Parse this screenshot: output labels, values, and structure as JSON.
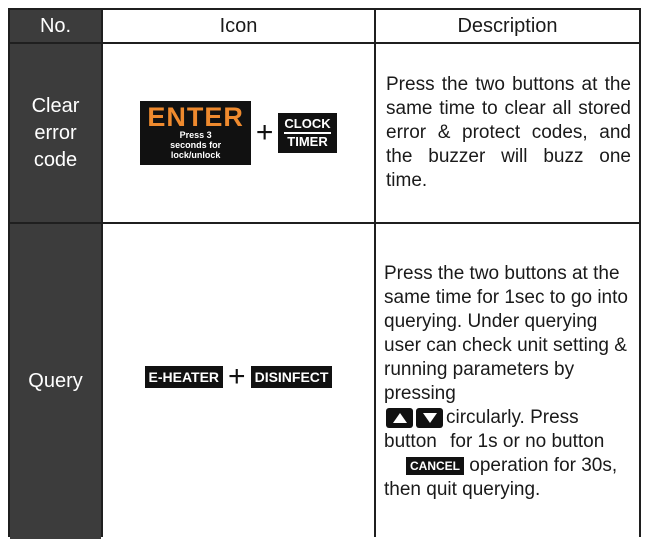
{
  "header": {
    "no": "No.",
    "icon": "Icon",
    "description": "Description"
  },
  "rows": [
    {
      "no_lines": [
        "Clear",
        "error",
        "code"
      ],
      "icon": {
        "key1_label": "ENTER",
        "key1_sub": "Press 3 seconds for lock/unlock",
        "plus": "+",
        "key2_top": "CLOCK",
        "key2_bottom": "TIMER"
      },
      "description": "Press the two buttons at the same time to clear all stored error & protect codes, and the buzzer will buzz one time."
    },
    {
      "no": "Query",
      "icon": {
        "key1_label": "E-HEATER",
        "plus": "+",
        "key2_label": "DISINFECT"
      },
      "description_parts": {
        "p1": "Press the two buttons at the same time for 1sec to go into querying. Under querying user can check unit setting & running parameters by pressing",
        "up_key_icon": "up-arrow",
        "down_key_icon": "down-arrow",
        "p2": "circularly. Press button",
        "p3": "for 1s or no button",
        "cancel_key": "CANCEL",
        "p4": "operation for 30s, then quit querying."
      }
    }
  ],
  "colors": {
    "dark_cell": "#3c3c3c",
    "key_bg": "#111111",
    "enter_orange": "#ef8a2e",
    "border": "#1f1f1f"
  }
}
